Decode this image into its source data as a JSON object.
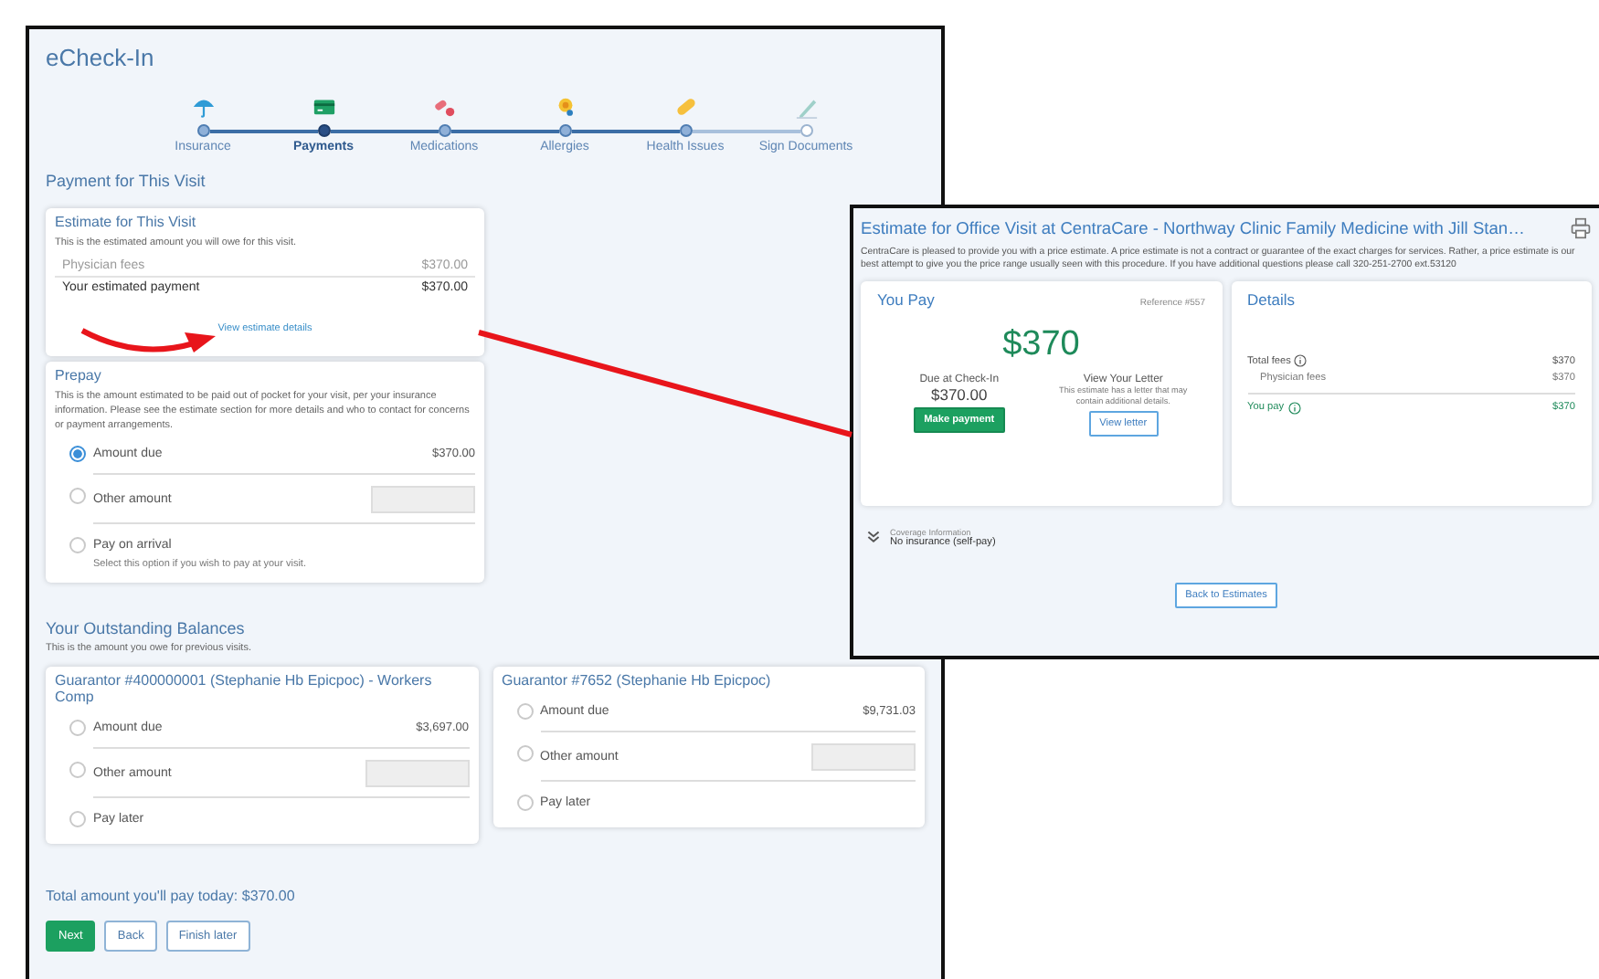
{
  "window": {
    "title": "eCheck-In"
  },
  "steps": [
    {
      "label": "Insurance",
      "selected": false,
      "completed": true
    },
    {
      "label": "Payments",
      "selected": true,
      "completed": false
    },
    {
      "label": "Medications",
      "selected": false,
      "completed": true
    },
    {
      "label": "Allergies",
      "selected": false,
      "completed": true
    },
    {
      "label": "Health Issues",
      "selected": false,
      "completed": true
    },
    {
      "label": "Sign Documents",
      "selected": false,
      "completed": false
    }
  ],
  "section_title": "Payment for This Visit",
  "estimate_card": {
    "title": "Estimate for This Visit",
    "description": "This is the estimated amount you will owe for this visit.",
    "rows": [
      {
        "kind": "fee",
        "label": "Physician fees",
        "amount": "$370.00"
      },
      {
        "kind": "total",
        "label": "Your estimated payment",
        "amount": "$370.00"
      }
    ],
    "link": "View estimate details"
  },
  "prepay": {
    "title": "Prepay",
    "description": "This is the amount estimated to be paid out of pocket for your visit, per your insurance information. Please see the estimate section for more details and who to contact for concerns or payment arrangements.",
    "options": [
      {
        "kind": "amount",
        "label": "Amount due",
        "amount": "$370.00",
        "selected": true
      },
      {
        "kind": "input",
        "label": "Other amount",
        "selected": false
      },
      {
        "kind": "plain",
        "label": "Pay on arrival",
        "description": "Select this option if you wish to pay at your visit.",
        "selected": false
      }
    ]
  },
  "balances": {
    "title": "Your Outstanding Balances",
    "description": "This is the amount you owe for previous visits.",
    "guarantors": [
      {
        "title": "Guarantor #400000001 (Stephanie Hb Epicpoc) - Workers Comp",
        "options": [
          {
            "kind": "amount",
            "label": "Amount due",
            "amount": "$3,697.00",
            "selected": false
          },
          {
            "kind": "input",
            "label": "Other amount",
            "selected": false
          },
          {
            "kind": "plain",
            "label": "Pay later",
            "selected": false
          }
        ]
      },
      {
        "title": "Guarantor #7652 (Stephanie Hb Epicpoc)",
        "options": [
          {
            "kind": "amount",
            "label": "Amount due",
            "amount": "$9,731.03",
            "selected": false
          },
          {
            "kind": "input",
            "label": "Other amount",
            "selected": false
          },
          {
            "kind": "plain",
            "label": "Pay later",
            "selected": false
          }
        ]
      }
    ]
  },
  "total": "Total amount you'll pay today: $370.00",
  "buttons": [
    {
      "label": "Next",
      "kind": "primary"
    },
    {
      "label": "Back",
      "kind": "secondary"
    },
    {
      "label": "Finish later",
      "kind": "secondary"
    }
  ],
  "estimate_window": {
    "title": "Estimate for Office Visit at CentraCare - Northway Clinic Family Medicine with Jill Stan…",
    "description": "CentraCare is pleased to provide you with a price estimate.  A price estimate is not a contract or guarantee of the exact charges for services. Rather, a price estimate is our best attempt to give you the price range usually seen with this procedure. If you have additional questions please call 320-251-2700 ext.53120",
    "you_pay": {
      "title": "You Pay",
      "reference": "Reference #557",
      "amount": "$370",
      "due_label": "Due at Check-In",
      "due_amount": "$370.00",
      "pay_button": "Make payment",
      "letter_title": "View Your Letter",
      "letter_text": "This estimate has a letter that may contain additional details.",
      "letter_button": "View letter"
    },
    "details": {
      "title": "Details",
      "rows": [
        {
          "kind": "total",
          "label": "Total fees",
          "amount": "$370",
          "info": true
        },
        {
          "kind": "sub",
          "label": "Physician fees",
          "amount": "$370",
          "info": false
        },
        {
          "kind": "you",
          "label": "You pay",
          "amount": "$370",
          "info": true
        }
      ]
    },
    "coverage": {
      "label": "Coverage Information",
      "value": "No insurance (self-pay)"
    },
    "back_button": "Back to Estimates"
  }
}
